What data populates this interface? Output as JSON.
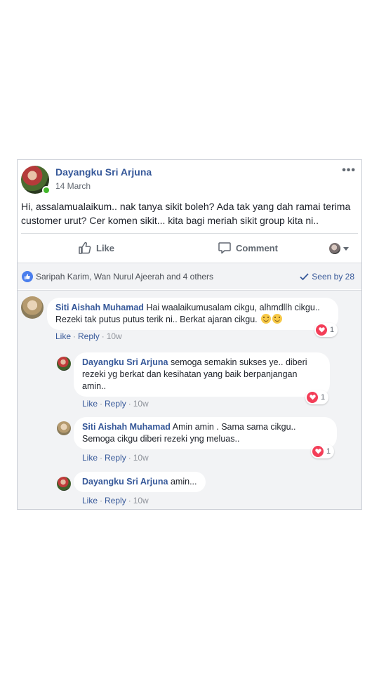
{
  "post": {
    "author": "Dayangku Sri Arjuna",
    "date": "14 March",
    "more": "•••",
    "text": "Hi, assalamualaikum.. nak tanya sikit boleh? Ada tak yang dah ramai terima customer urut? Cer komen sikit... kita bagi meriah sikit group kita ni..",
    "actions": {
      "like": "Like",
      "comment": "Comment"
    }
  },
  "reactions": {
    "reactors": "Saripah Karim, Wan Nurul Ajeerah and 4 others",
    "seen": "Seen by 28"
  },
  "comments": [
    {
      "name": "Siti Aishah Muhamad",
      "text": "Hai waalaikumusalam cikgu, alhmdllh cikgu.. Rezeki tak putus putus terik ni.. Berkat ajaran cikgu.",
      "like": "Like",
      "reply": "Reply",
      "time": "10w",
      "reaction_count": "1"
    },
    {
      "name": "Dayangku Sri Arjuna",
      "text": "semoga semakin sukses ye.. diberi rezeki yg berkat dan kesihatan yang baik berpanjangan amin..",
      "like": "Like",
      "reply": "Reply",
      "time": "10w",
      "reaction_count": "1"
    },
    {
      "name": "Siti Aishah Muhamad",
      "text": "Amin amin . Sama sama cikgu.. Semoga cikgu diberi rezeki yng meluas..",
      "like": "Like",
      "reply": "Reply",
      "time": "10w",
      "reaction_count": "1"
    },
    {
      "name": "Dayangku Sri Arjuna",
      "text": "amin...",
      "like": "Like",
      "reply": "Reply",
      "time": "10w"
    }
  ],
  "colors": {
    "link": "#365899",
    "like_blue": "#4a7eed",
    "heart_red": "#f33e58",
    "online_green": "#42b72a"
  }
}
